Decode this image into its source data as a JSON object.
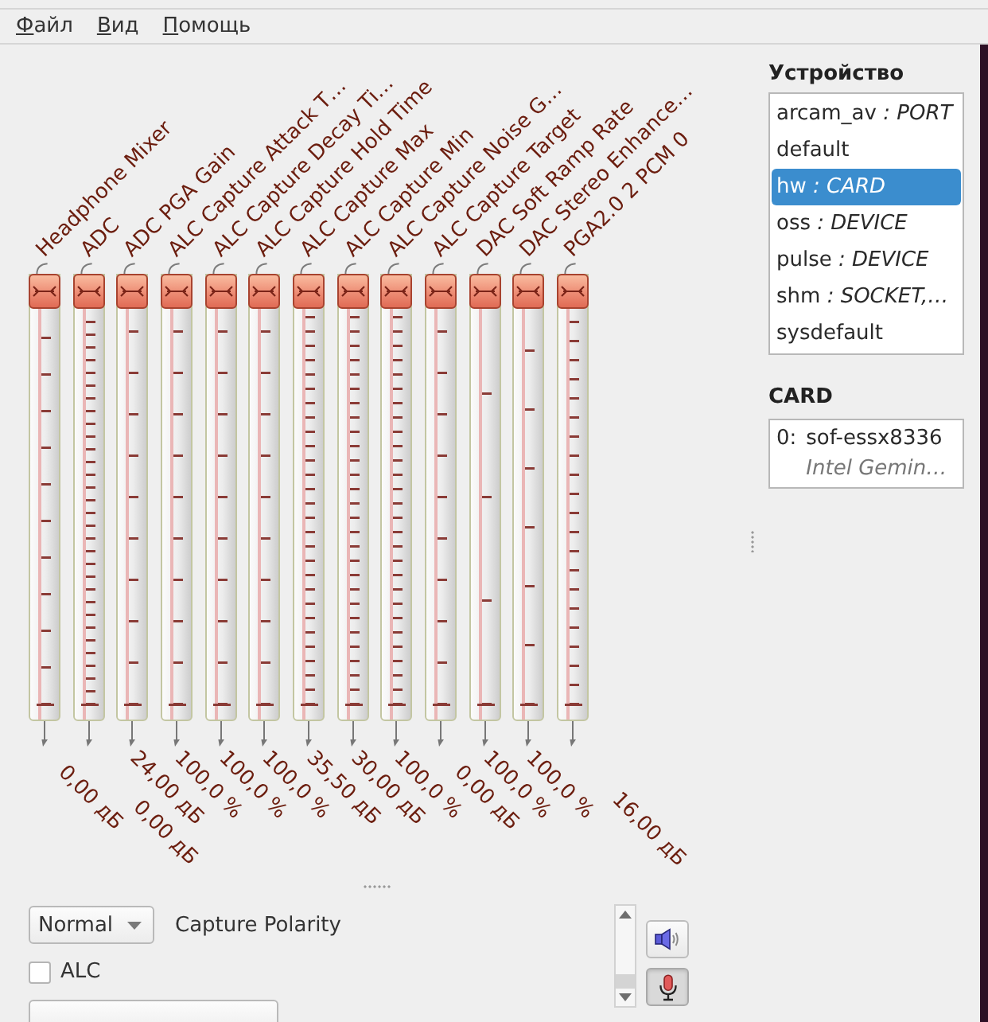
{
  "menu": [
    "Файл",
    "Вид",
    "Помощь"
  ],
  "channels": [
    {
      "name": "Headphone Mixer",
      "level": 1,
      "value": "0,00 дБ"
    },
    {
      "name": "ADC",
      "level": 1,
      "value": "0,00 дБ"
    },
    {
      "name": "ADC PGA Gain",
      "level": 1,
      "value": "24,00 дБ"
    },
    {
      "name": "ALC Capture Attack T…",
      "level": 1,
      "value": "100,0 %"
    },
    {
      "name": "ALC Capture Decay Ti…",
      "level": 1,
      "value": "100,0 %"
    },
    {
      "name": "ALC Capture Hold Time",
      "level": 1,
      "value": "100,0 %"
    },
    {
      "name": "ALC Capture Max",
      "level": 1,
      "value": "35,50 дБ"
    },
    {
      "name": "ALC Capture Min",
      "level": 1,
      "value": "30,00 дБ"
    },
    {
      "name": "ALC Capture Noise G…",
      "level": 1,
      "value": "100,0 %"
    },
    {
      "name": "ALC Capture Target",
      "level": 1,
      "value": "0,00 дБ"
    },
    {
      "name": "DAC Soft Ramp Rate",
      "level": 1,
      "value": "100,0 %"
    },
    {
      "name": "DAC Stereo Enhance…",
      "level": 1,
      "value": "100,0 %"
    },
    {
      "name": "PGA2.0 2 PCM 0",
      "level": 1,
      "value": "16,00 дБ"
    }
  ],
  "switches": [
    {
      "kind": "enum",
      "choice": "Normal",
      "label": "Capture Polarity"
    },
    {
      "kind": "check",
      "label": "ALC",
      "checked": false
    },
    {
      "kind": "enum"
    }
  ],
  "view_buttons": [
    {
      "kind": "playback",
      "selected": false
    },
    {
      "kind": "capture",
      "selected": true
    }
  ],
  "devices": {
    "title": "Устройство",
    "items": [
      {
        "label": "arcam_av *: PORT*",
        "selected": false
      },
      {
        "label": "default",
        "selected": false
      },
      {
        "label": "hw *: CARD*",
        "selected": true
      },
      {
        "label": "oss *: DEVICE*",
        "selected": false
      },
      {
        "label": "pulse *: DEVICE*",
        "selected": false
      },
      {
        "label": "shm *: SOCKET,…*",
        "selected": false
      },
      {
        "label": "sysdefault",
        "selected": false
      }
    ]
  },
  "cards": {
    "title": "CARD",
    "items": [
      {
        "index": "0:",
        "name": "sof-essx8336",
        "description": "Intel Gemin…"
      }
    ]
  }
}
